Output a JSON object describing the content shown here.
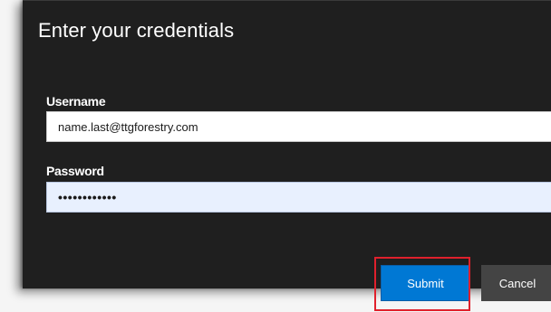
{
  "dialog": {
    "title": "Enter your credentials",
    "username": {
      "label": "Username",
      "value": "name.last@ttgforestry.com"
    },
    "password": {
      "label": "Password",
      "value": "••••••••••••"
    },
    "buttons": {
      "submit_label": "Submit",
      "cancel_label": "Cancel"
    }
  },
  "colors": {
    "dialog_background": "#1f1f1f",
    "submit_button": "#0078d4",
    "cancel_button": "#444444",
    "password_field_background": "#e8f0fe",
    "highlight_outline": "#e0202c"
  }
}
